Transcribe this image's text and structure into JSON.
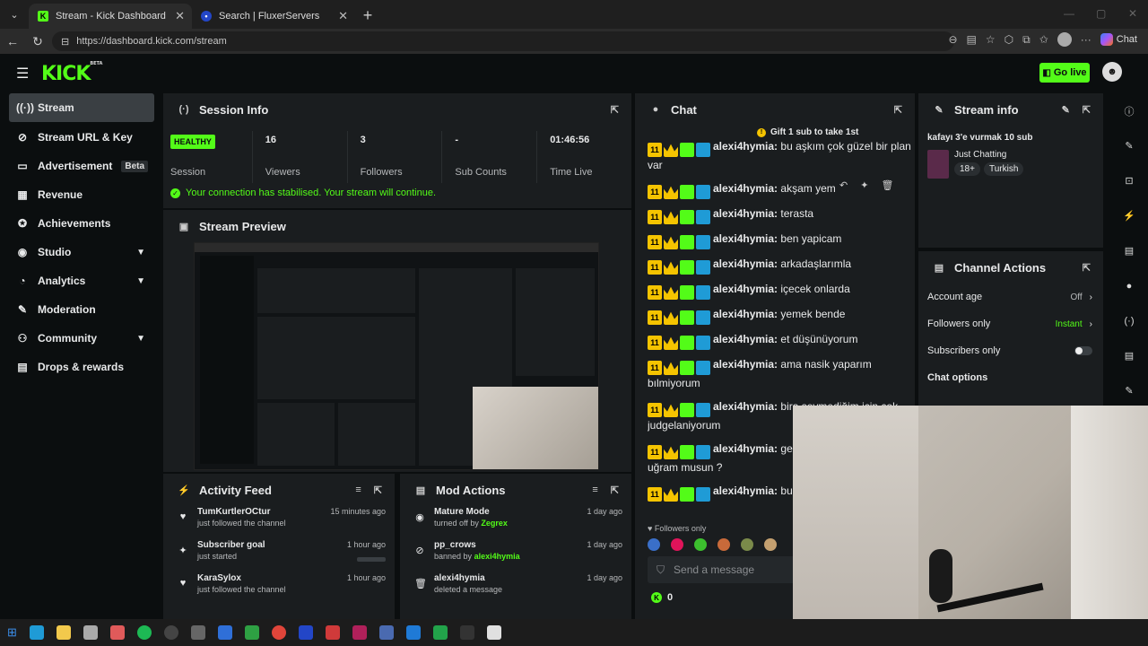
{
  "browser": {
    "tabs": [
      {
        "title": "Stream - Kick Dashboard",
        "active": true
      },
      {
        "title": "Search | FluxerServers",
        "active": false
      }
    ],
    "url": "https://dashboard.kick.com/stream",
    "copilot_label": "Chat"
  },
  "header": {
    "logo": "KICK",
    "logo_badge": "BETA",
    "go_live_label": "Go live"
  },
  "sidebar": {
    "items": [
      {
        "label": "Stream",
        "icon": "broadcast-icon"
      },
      {
        "label": "Stream URL & Key",
        "icon": "link-icon"
      },
      {
        "label": "Advertisement",
        "icon": "tv-icon",
        "badge": "Beta"
      },
      {
        "label": "Revenue",
        "icon": "dollar-icon"
      },
      {
        "label": "Achievements",
        "icon": "trophy-icon"
      },
      {
        "label": "Studio",
        "icon": "studio-icon"
      },
      {
        "label": "Analytics",
        "icon": "analytics-icon"
      },
      {
        "label": "Moderation",
        "icon": "wrench-icon"
      },
      {
        "label": "Community",
        "icon": "community-icon"
      },
      {
        "label": "Drops & rewards",
        "icon": "gift-icon"
      }
    ]
  },
  "session": {
    "title": "Session Info",
    "status_badge": "HEALTHY",
    "status_label": "Session",
    "stats": [
      {
        "value": "16",
        "label": "Viewers"
      },
      {
        "value": "3",
        "label": "Followers"
      },
      {
        "value": "-",
        "label": "Sub Counts"
      },
      {
        "value": "01:46:56",
        "label": "Time Live"
      }
    ],
    "connection_message": "Your connection has stabilised. Your stream will continue."
  },
  "preview": {
    "title": "Stream Preview"
  },
  "activity": {
    "title": "Activity Feed",
    "items": [
      {
        "title": "TumKurtlerOCtur",
        "sub": "just followed the channel",
        "time": "15 minutes ago"
      },
      {
        "title": "Subscriber goal",
        "sub": "just started",
        "time": "1 hour ago"
      },
      {
        "title": "KaraSylox",
        "sub": "just followed the channel",
        "time": "1 hour ago"
      }
    ]
  },
  "mod_actions": {
    "title": "Mod Actions",
    "items": [
      {
        "title": "Mature Mode",
        "sub_prefix": "turned off by",
        "sub_user": "Zegrex",
        "time": "1 day ago"
      },
      {
        "title": "pp_crows",
        "sub_prefix": "banned by",
        "sub_user": "alexi4hymia",
        "time": "1 day ago"
      },
      {
        "title": "alexi4hymia",
        "sub_prefix": "deleted a message",
        "sub_user": "",
        "time": "1 day ago"
      }
    ]
  },
  "chat": {
    "title": "Chat",
    "gift_banner": "Gift 1 sub to take 1st",
    "messages": [
      {
        "user": "alexi4hymia:",
        "text": "bu aşkım çok güzel bir plan var"
      },
      {
        "user": "alexi4hymia:",
        "text": "akşam yem"
      },
      {
        "user": "alexi4hymia:",
        "text": "terasta"
      },
      {
        "user": "alexi4hymia:",
        "text": "ben yapicam"
      },
      {
        "user": "alexi4hymia:",
        "text": "arkadaşlarımla"
      },
      {
        "user": "alexi4hymia:",
        "text": "içecek onlarda"
      },
      {
        "user": "alexi4hymia:",
        "text": "yemek bende"
      },
      {
        "user": "alexi4hymia:",
        "text": "et düşünüyorum"
      },
      {
        "user": "alexi4hymia:",
        "text": "ama nasik yaparım bılmiyorum"
      },
      {
        "user": "alexi4hymia:",
        "text": "bira sevmediğim için çok judgelaniyorum"
      },
      {
        "user": "alexi4hymia:",
        "text": "gerek çünkü markete uğram musun ?"
      },
      {
        "user": "alexi4hymia:",
        "text": "buluşalım sonda"
      }
    ],
    "followers_only_label": "Followers only",
    "input_placeholder": "Send a message",
    "kicks_count": "0"
  },
  "stream_info": {
    "title": "Stream info",
    "stream_title": "kafayı 3'e vurmak 10 sub",
    "category": "Just Chatting",
    "tags": [
      "18+",
      "Turkish"
    ]
  },
  "channel_actions": {
    "title": "Channel Actions",
    "rows": [
      {
        "label": "Account age",
        "value": "Off"
      },
      {
        "label": "Followers only",
        "value": "Instant"
      },
      {
        "label": "Subscribers only",
        "value": ""
      }
    ],
    "chat_options_label": "Chat options"
  },
  "colors": {
    "brand": "#53fc18",
    "panel": "#1a1d1f",
    "background": "#0b0e0f"
  }
}
